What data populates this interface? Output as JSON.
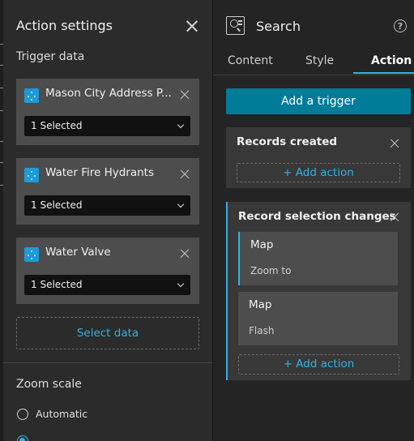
{
  "action_settings": {
    "title": "Action settings",
    "trigger_data_label": "Trigger data",
    "triggers": [
      {
        "name": "Mason City Address P...",
        "selected": "1 Selected"
      },
      {
        "name": "Water Fire Hydrants",
        "selected": "1 Selected"
      },
      {
        "name": "Water Valve",
        "selected": "1 Selected"
      }
    ],
    "select_data_label": "Select data",
    "zoom_scale_label": "Zoom scale",
    "zoom_options": [
      {
        "label": "Automatic",
        "selected": false
      },
      {
        "label": "",
        "selected": true
      }
    ]
  },
  "widget": {
    "title": "Search",
    "tabs": [
      "Content",
      "Style",
      "Action"
    ],
    "active_tab": "Action",
    "add_trigger_label": "Add a trigger",
    "trigger_panels": [
      {
        "title": "Records created",
        "actions": [],
        "add_action_label": "+ Add action"
      },
      {
        "title": "Record selection changes",
        "actions": [
          {
            "title": "Map",
            "subtitle": "Zoom to"
          },
          {
            "title": "Map",
            "subtitle": "Flash"
          }
        ],
        "add_action_label": "+ Add action"
      }
    ]
  },
  "colors": {
    "accent": "#2fb3e3",
    "primary_button": "#007c99",
    "panel_bg": "#2b2b2b",
    "card_bg": "#4d4d4d",
    "layer_icon": "#1e9ad6"
  },
  "icons": {
    "layer": "feature-layer-icon",
    "close": "close-icon",
    "widget": "search-widget-icon",
    "help": "help-icon",
    "dropdown": "chevron-down-icon"
  }
}
